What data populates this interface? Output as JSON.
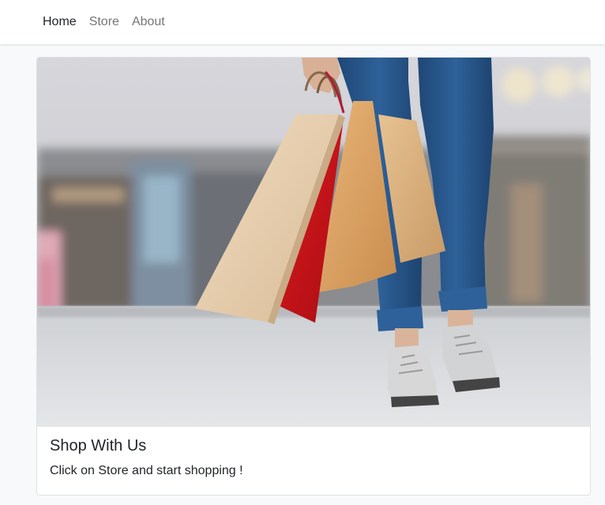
{
  "nav": {
    "items": [
      {
        "label": "Home",
        "active": true
      },
      {
        "label": "Store",
        "active": false
      },
      {
        "label": "About",
        "active": false
      }
    ]
  },
  "card": {
    "image": "shopping-bags-photo",
    "title": "Shop With Us",
    "text": "Click on Store and start shopping !"
  },
  "colors": {
    "background": "#f8f9fa",
    "nav_active": "#212529",
    "nav_muted": "#737373",
    "bag_red": "#d4141a",
    "bag_kraft": "#d9a870",
    "jeans": "#2a5a8f"
  }
}
